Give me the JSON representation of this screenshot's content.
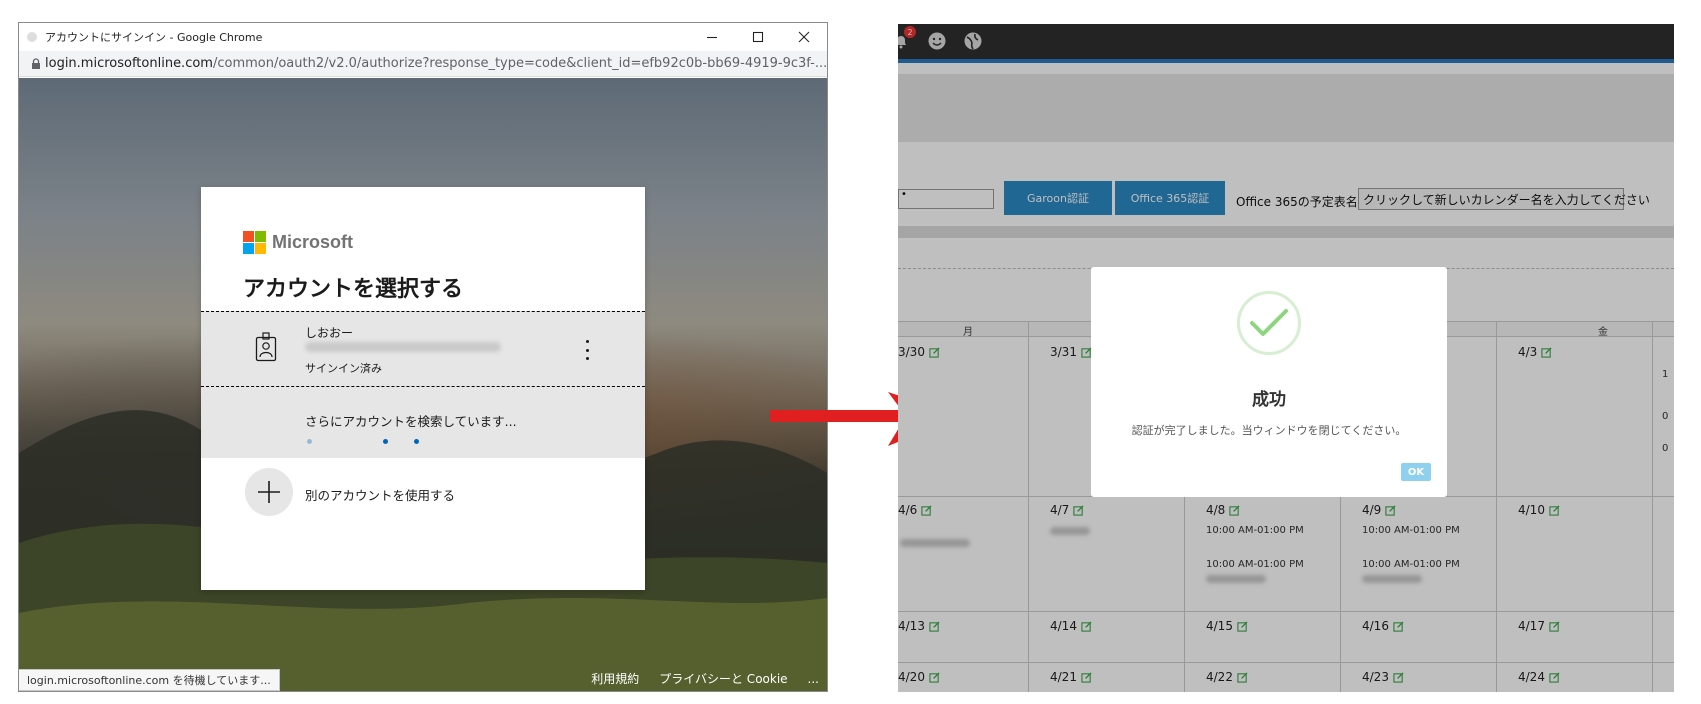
{
  "chrome_window": {
    "title": "アカウントにサインイン - Google Chrome",
    "url_host": "login.microsoftonline.com",
    "url_path": "/common/oauth2/v2.0/authorize?response_type=code&client_id=efb92c0b-bb69-4919-9c3f-...",
    "status_text": "login.microsoftonline.com を待機しています..."
  },
  "signin": {
    "brand": "Microsoft",
    "heading": "アカウントを選択する",
    "account": {
      "name": "しおおー",
      "status": "サインイン済み"
    },
    "searching_text": "さらにアカウントを検索しています...",
    "other_account": "別のアカウントを使用する",
    "footer": {
      "terms": "利用規約",
      "privacy": "プライバシーと Cookie",
      "more": "..."
    }
  },
  "garoon": {
    "notification_count": "2",
    "form": {
      "input1_value": "•",
      "garoon_auth_button": "Garoon認証",
      "o365_auth_button": "Office 365認証",
      "calendar_label": "Office 365の予定表名:",
      "calendar_input": "クリックして新しいカレンダー名を入力してください"
    },
    "weekday_headers": {
      "mon": "月",
      "fri": "金"
    },
    "dates": {
      "r1c1": "3/30",
      "r1c2": "3/31",
      "r1c5": "4/3",
      "r2c1": "4/6",
      "r2c2": "4/7",
      "r2c3": "4/8",
      "r2c4": "4/9",
      "r2c5": "4/10",
      "r3c1": "4/13",
      "r3c2": "4/14",
      "r3c3": "4/15",
      "r3c4": "4/16",
      "r3c5": "4/17",
      "r4c1": "4/20",
      "r4c2": "4/21",
      "r4c3": "4/22",
      "r4c4": "4/23",
      "r4c5": "4/24"
    },
    "edge_marks": {
      "r1a": "1",
      "r1b": "0",
      "r1c": "0"
    },
    "events": {
      "r2c3_1": "10:00 AM-01:00 PM",
      "r2c3_2": "10:00 AM-01:00 PM",
      "r2c4_1": "10:00 AM-01:00 PM",
      "r2c4_2": "10:00 AM-01:00 PM"
    },
    "modal": {
      "title": "成功",
      "message": "認証が完了しました。当ウィンドウを閉じてください。",
      "ok": "OK"
    }
  },
  "colors": {
    "arrow": "#e02020",
    "garoon_button": "#2b8ac4",
    "ok_button": "#8fd0ef",
    "check": "#8ed57f"
  }
}
